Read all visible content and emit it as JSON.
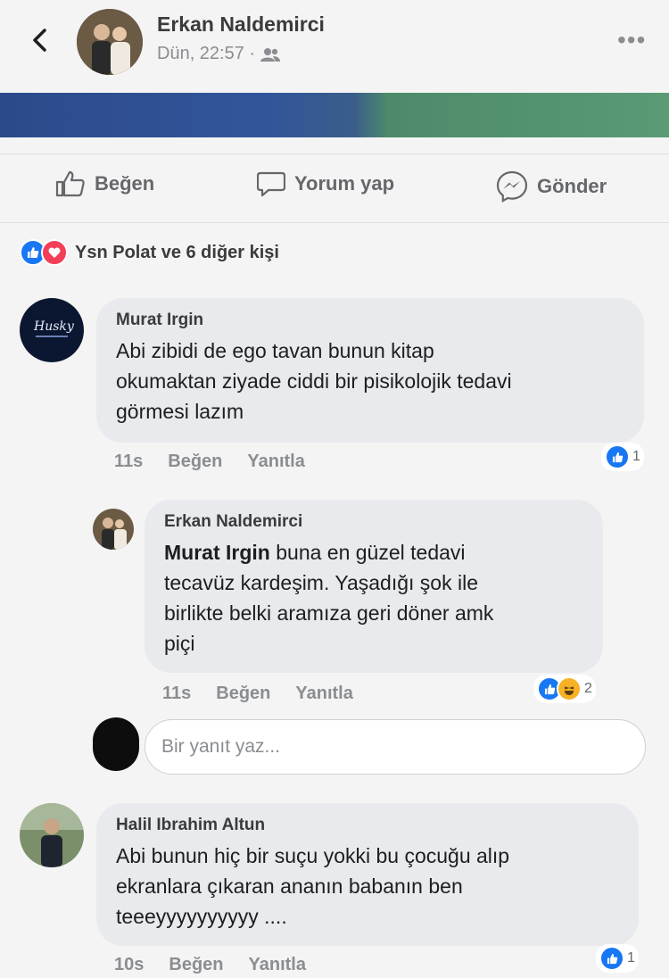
{
  "header": {
    "author": "Erkan Naldemirci",
    "timestamp": "Dün, 22:57 ·",
    "audience_icon": "friends-icon",
    "more_label": "•••"
  },
  "actions": [
    {
      "label": "Beğen",
      "icon": "thumbs-up-icon"
    },
    {
      "label": "Yorum yap",
      "icon": "comment-icon"
    },
    {
      "label": "Gönder",
      "icon": "messenger-icon"
    }
  ],
  "reactions_summary": "Ysn Polat ve 6 diğer kişi",
  "comments": [
    {
      "author": "Murat Irgin",
      "text_lines": [
        "Abi zibidi de ego tavan bunun kitap",
        "okumaktan ziyade ciddi bir pisikolojik tedavi",
        "görmesi lazım"
      ],
      "time": "11s",
      "like": "Beğen",
      "reply": "Yanıtla",
      "reaction_count": "1",
      "reply_item": {
        "author": "Erkan Naldemirci",
        "mention": "Murat Irgin",
        "text_lines": [
          " buna en güzel tedavi",
          "tecavüz kardeşim. Yaşadığı şok ile",
          "birlikte belki aramıza geri döner amk",
          "piçi"
        ],
        "time": "11s",
        "like": "Beğen",
        "reply": "Yanıtla",
        "reaction_count": "2"
      },
      "reply_placeholder": "Bir yanıt yaz..."
    },
    {
      "author": "Halil Ibrahim Altun",
      "text_lines": [
        "Abi bunun hiç bir suçu yokki bu çocuğu alıp",
        "ekranlara çıkaran ananın babanın ben",
        "teeeyyyyyyyyyy ...."
      ],
      "time": "10s",
      "like": "Beğen",
      "reply": "Yanıtla",
      "reaction_count": "1"
    }
  ],
  "colors": {
    "like_blue": "#1877f2",
    "love_red": "#f33e58",
    "haha_yellow": "#f7b125",
    "bubble_gray": "#e9eaed"
  }
}
